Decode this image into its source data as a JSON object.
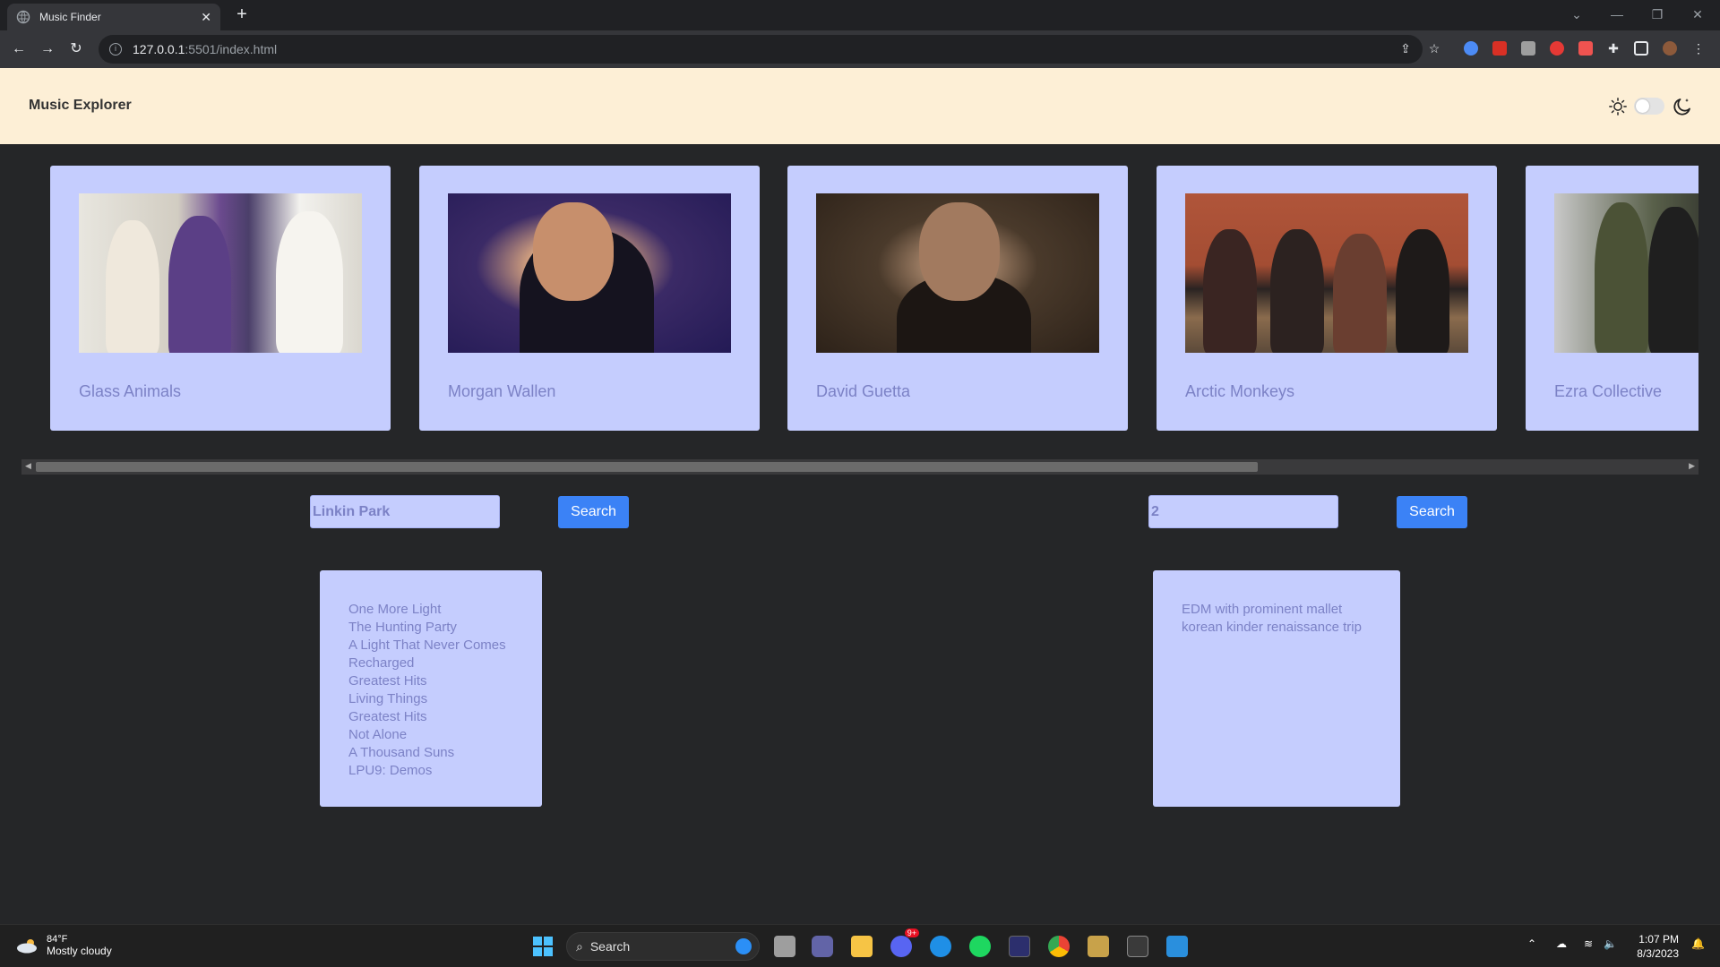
{
  "browser": {
    "tab_title": "Music Finder",
    "close_glyph": "✕",
    "newtab_glyph": "+",
    "url_host": "127.0.0.1",
    "url_path": ":5501/index.html"
  },
  "app": {
    "brand": "Music Explorer"
  },
  "artists": [
    {
      "name": "Glass Animals"
    },
    {
      "name": "Morgan Wallen"
    },
    {
      "name": "David Guetta"
    },
    {
      "name": "Arctic Monkeys"
    },
    {
      "name": "Ezra Collective"
    }
  ],
  "left_search": {
    "value": "Linkin Park",
    "button": "Search",
    "results": [
      "One More Light",
      "The Hunting Party",
      "A Light That Never Comes",
      "Recharged",
      "Greatest Hits",
      "Living Things",
      "Greatest Hits",
      "Not Alone",
      "A Thousand Suns",
      "LPU9: Demos"
    ]
  },
  "right_search": {
    "value": "2",
    "button": "Search",
    "results": [
      "EDM with prominent mallet",
      "korean kinder renaissance trip"
    ]
  },
  "taskbar": {
    "temperature": "84°F",
    "weather": "Mostly cloudy",
    "search_label": "Search",
    "time": "1:07 PM",
    "date": "8/3/2023",
    "badge": "9+"
  },
  "colors": {
    "header_bg": "#fdefd6",
    "card_bg": "#c5cdfe",
    "card_text": "#7c82c6",
    "button": "#3b82f6",
    "page_bg": "#252628"
  }
}
